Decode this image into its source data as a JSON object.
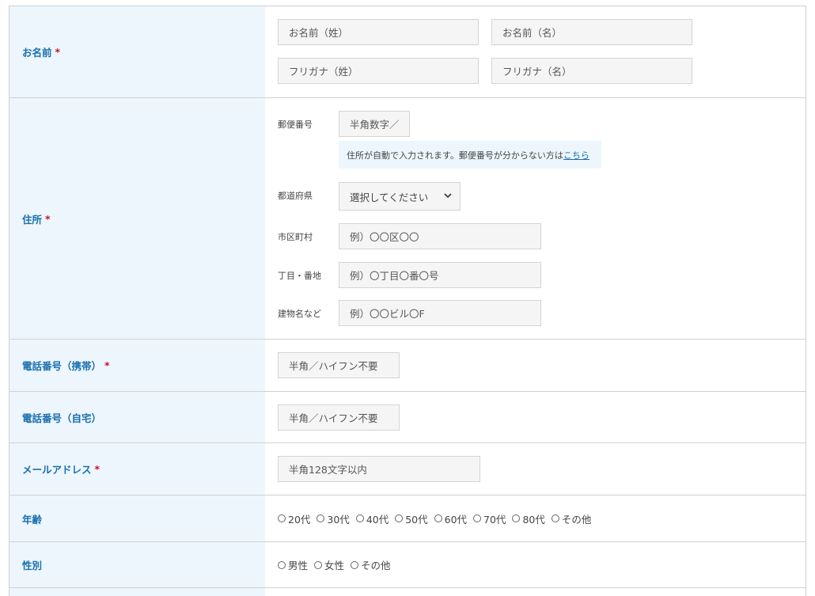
{
  "rows": {
    "name": {
      "label": "お名前",
      "required_mark": "*",
      "last_name_placeholder": "お名前（姓）",
      "first_name_placeholder": "お名前（名）",
      "last_kana_placeholder": "フリガナ（姓）",
      "first_kana_placeholder": "フリガナ（名）"
    },
    "address": {
      "label": "住所",
      "required_mark": "*",
      "zip_label": "郵便番号",
      "zip_placeholder": "半角数字／",
      "zip_help": "住所が自動で入力されます。郵便番号が分からない方は",
      "zip_help_link": "こちら",
      "pref_label": "都道府県",
      "pref_selected": "選択してください",
      "city_label": "市区町村",
      "city_placeholder": "例）〇〇区〇〇",
      "street_label": "丁目・番地",
      "street_placeholder": "例）〇丁目〇番〇号",
      "building_label": "建物名など",
      "building_placeholder": "例）〇〇ビル〇F"
    },
    "mobile": {
      "label": "電話番号（携帯）",
      "required_mark": "*",
      "placeholder": "半角／ハイフン不要"
    },
    "home_phone": {
      "label": "電話番号（自宅）",
      "placeholder": "半角／ハイフン不要"
    },
    "email": {
      "label": "メールアドレス",
      "required_mark": "*",
      "placeholder": "半角128文字以内"
    },
    "age": {
      "label": "年齢",
      "options": [
        "20代",
        "30代",
        "40代",
        "50代",
        "60代",
        "70代",
        "80代",
        "その他"
      ]
    },
    "gender": {
      "label": "性別",
      "options": [
        "男性",
        "女性",
        "その他"
      ]
    }
  },
  "colors": {
    "label_bg": "#edf6fd",
    "label_text": "#1a6fae",
    "required": "#c8102e",
    "input_bg": "#f5f5f5",
    "border": "#d0d0d0"
  }
}
